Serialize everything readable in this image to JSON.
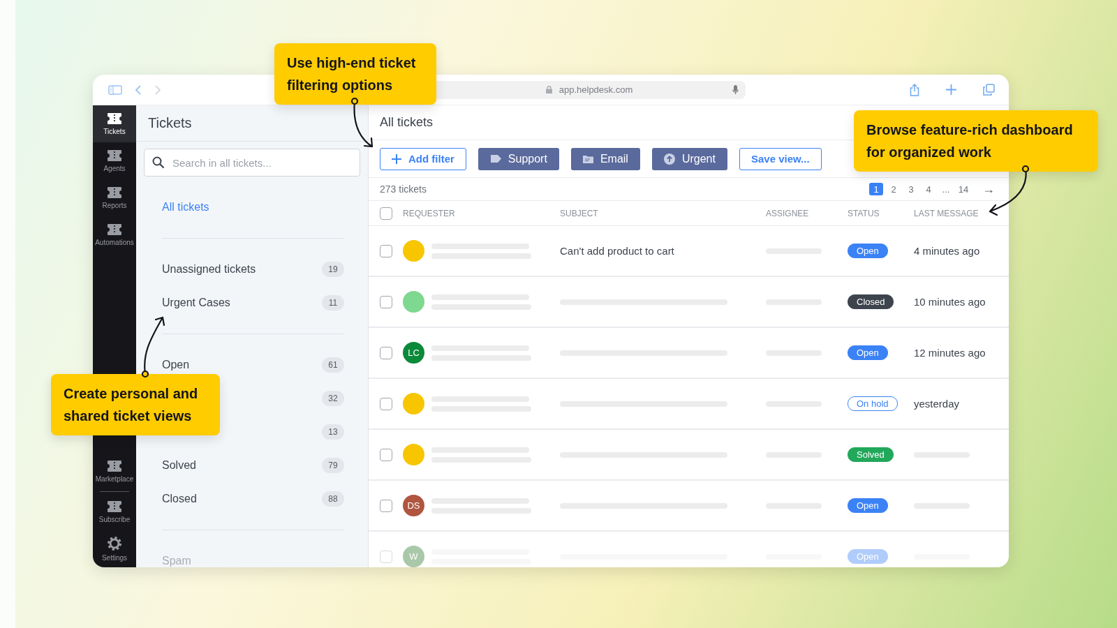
{
  "browser": {
    "address": "app.helpdesk.com"
  },
  "nav": {
    "items": [
      {
        "label": "Tickets",
        "selected": true
      },
      {
        "label": "Agents",
        "selected": false
      },
      {
        "label": "Reports",
        "selected": false
      },
      {
        "label": "Automations",
        "selected": false
      }
    ],
    "bottom_items": [
      {
        "label": "Marketplace",
        "selected": false
      },
      {
        "label": "Subscribe",
        "selected": false
      },
      {
        "label": "Settings",
        "selected": false
      }
    ]
  },
  "sidebar": {
    "title": "Tickets",
    "search": {
      "placeholder": "Search in all tickets..."
    },
    "sections": [
      {
        "items": [
          {
            "label": "All tickets",
            "selected": true,
            "faded": false
          }
        ]
      },
      {
        "items": [
          {
            "label": "Unassigned tickets",
            "count": "19",
            "selected": false,
            "faded": false
          },
          {
            "label": "Urgent Cases",
            "count": "11",
            "selected": false,
            "faded": false
          }
        ]
      },
      {
        "items": [
          {
            "label": "Open",
            "count": "61",
            "selected": false,
            "faded": false
          },
          {
            "count": "32",
            "selected": false,
            "faded": false
          },
          {
            "count": "13",
            "selected": false,
            "faded": false
          },
          {
            "label": "Solved",
            "count": "79",
            "selected": false,
            "faded": false
          },
          {
            "label": "Closed",
            "count": "88",
            "selected": false,
            "faded": false
          }
        ]
      },
      {
        "items": [
          {
            "label": "Spam",
            "selected": false,
            "faded": true
          }
        ]
      }
    ]
  },
  "main": {
    "title": "All tickets",
    "filters": [
      {
        "label": "Add filter",
        "kind": "add"
      },
      {
        "label": "Support",
        "kind": "tag"
      },
      {
        "label": "Email",
        "kind": "email"
      },
      {
        "label": "Urgent",
        "kind": "urgent"
      },
      {
        "label": "Save view...",
        "kind": "save"
      }
    ],
    "count": "273 tickets",
    "pagination": {
      "pages": [
        {
          "label": "1",
          "selected": true
        },
        {
          "label": "2",
          "selected": false
        },
        {
          "label": "3",
          "selected": false
        },
        {
          "label": "4",
          "selected": false
        },
        {
          "label": "...",
          "selected": false
        },
        {
          "label": "14",
          "selected": false
        }
      ],
      "next": "→"
    },
    "table": {
      "select_all": {
        "checked": false
      },
      "columns": [
        "REQUESTER",
        "SUBJECT",
        "ASSIGNEE",
        "STATUS",
        "LAST MESSAGE"
      ],
      "rows": [
        {
          "checked": false,
          "faded": false,
          "avatar": {
            "kind": "photo",
            "color": "#f7c600"
          },
          "subject": "Can't add product to cart",
          "status": {
            "label": "Open",
            "kind": "open"
          },
          "last_message": "4 minutes ago"
        },
        {
          "checked": false,
          "faded": false,
          "avatar": {
            "kind": "photo",
            "color": "#7ed88f"
          },
          "status": {
            "label": "Closed",
            "kind": "closed"
          },
          "last_message": "10 minutes ago"
        },
        {
          "checked": false,
          "faded": false,
          "avatar": {
            "kind": "initials",
            "initials": "LC",
            "color": "#0b8a3a"
          },
          "status": {
            "label": "Open",
            "kind": "open"
          },
          "last_message": "12 minutes ago"
        },
        {
          "checked": false,
          "faded": false,
          "avatar": {
            "kind": "photo",
            "color": "#f7c600"
          },
          "status": {
            "label": "On hold",
            "kind": "on_hold"
          },
          "last_message": "yesterday"
        },
        {
          "checked": false,
          "faded": false,
          "avatar": {
            "kind": "photo",
            "color": "#f7c600"
          },
          "status": {
            "label": "Solved",
            "kind": "solved"
          }
        },
        {
          "checked": false,
          "faded": false,
          "avatar": {
            "kind": "initials",
            "initials": "DS",
            "color": "#b0553f"
          },
          "status": {
            "label": "Open",
            "kind": "open"
          }
        },
        {
          "checked": false,
          "faded": true,
          "avatar": {
            "kind": "initials",
            "initials": "W",
            "color": "#a9c8a9"
          },
          "status": {
            "label": "Open",
            "kind": "open"
          }
        }
      ]
    }
  },
  "callouts": [
    {
      "text": "Use high-end ticket filtering options"
    },
    {
      "text": "Browse feature-rich dashboard for organized work"
    },
    {
      "text": "Create personal and shared ticket views"
    }
  ]
}
